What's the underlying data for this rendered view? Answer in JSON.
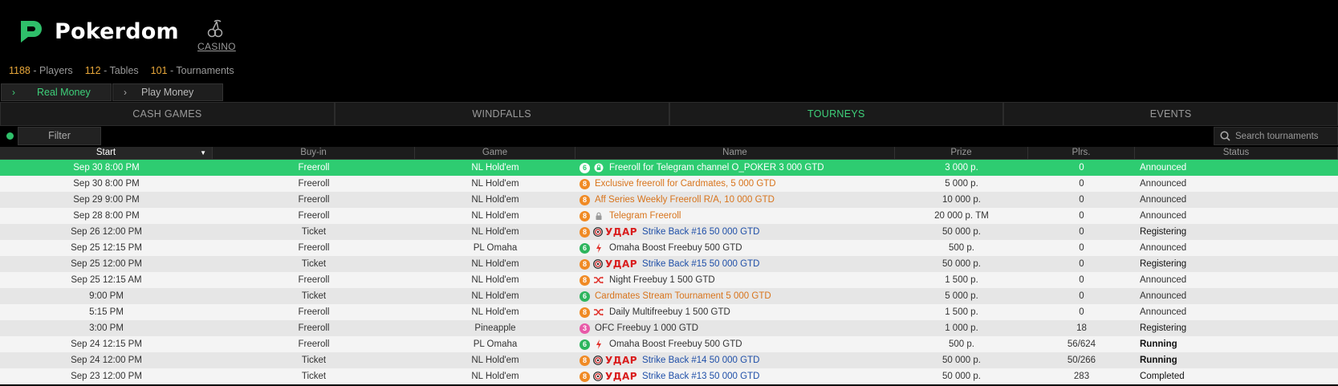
{
  "brand": {
    "name": "Pokerdom",
    "casino_label": "CASINO",
    "accent": "#2fbf6a"
  },
  "stats": [
    {
      "value": "1188",
      "label": " - Players"
    },
    {
      "value": "112",
      "label": " - Tables"
    },
    {
      "value": "101",
      "label": " - Tournaments"
    }
  ],
  "money_tabs": [
    {
      "label": "Real Money",
      "active": true
    },
    {
      "label": "Play Money",
      "active": false
    }
  ],
  "main_tabs": [
    {
      "label": "CASH GAMES",
      "active": false
    },
    {
      "label": "WINDFALLS",
      "active": false
    },
    {
      "label": "TOURNEYS",
      "active": true
    },
    {
      "label": "EVENTS",
      "active": false
    }
  ],
  "filter": {
    "label": "Filter"
  },
  "search": {
    "placeholder": "Search tournaments"
  },
  "columns": [
    "Start",
    "Buy-in",
    "Game",
    "Name",
    "Prize",
    "Plrs.",
    "Status"
  ],
  "rows": [
    {
      "start": "Sep 30 8:00 PM",
      "buyin": "Freeroll",
      "game": "NL Hold'em",
      "badge": "6",
      "badge_color": "green",
      "icon": "lock-icon",
      "udar": false,
      "name": "Freeroll for Telegram channel O_POKER 3 000 GTD",
      "name_style": "plain",
      "prize": "3 000 р.",
      "plrs": "0",
      "status": "Announced",
      "status_style": "normal",
      "selected": true
    },
    {
      "start": "Sep 30 8:00 PM",
      "buyin": "Freeroll",
      "game": "NL Hold'em",
      "badge": "8",
      "badge_color": "orange",
      "icon": "",
      "udar": false,
      "name": "Exclusive freeroll for Cardmates, 5 000 GTD",
      "name_style": "orange",
      "prize": "5 000 р.",
      "plrs": "0",
      "status": "Announced",
      "status_style": "normal"
    },
    {
      "start": "Sep 29 9:00 PM",
      "buyin": "Freeroll",
      "game": "NL Hold'em",
      "badge": "8",
      "badge_color": "orange",
      "icon": "",
      "udar": false,
      "name": "Aff Series Weekly Freeroll R/A, 10 000 GTD",
      "name_style": "orange",
      "prize": "10 000 р.",
      "plrs": "0",
      "status": "Announced",
      "status_style": "normal"
    },
    {
      "start": "Sep 28 8:00 PM",
      "buyin": "Freeroll",
      "game": "NL Hold'em",
      "badge": "8",
      "badge_color": "orange",
      "icon": "lock-icon",
      "udar": false,
      "name": "Telegram Freeroll",
      "name_style": "orange",
      "prize": "20 000 р. TM",
      "plrs": "0",
      "status": "Announced",
      "status_style": "normal"
    },
    {
      "start": "Sep 26 12:00 PM",
      "buyin": "Ticket",
      "game": "NL Hold'em",
      "badge": "8",
      "badge_color": "orange",
      "icon": "",
      "udar": true,
      "udar_text": "УДАР",
      "name": "Strike Back #16 50 000 GTD",
      "name_style": "blue",
      "prize": "50 000 р.",
      "plrs": "0",
      "status": "Registering",
      "status_style": "medium"
    },
    {
      "start": "Sep 25 12:15 PM",
      "buyin": "Freeroll",
      "game": "PL Omaha",
      "badge": "6",
      "badge_color": "green",
      "icon": "lightning-icon",
      "udar": false,
      "name": "Omaha Boost Freebuy 500 GTD",
      "name_style": "plain",
      "prize": "500 р.",
      "plrs": "0",
      "status": "Announced",
      "status_style": "normal"
    },
    {
      "start": "Sep 25 12:00 PM",
      "buyin": "Ticket",
      "game": "NL Hold'em",
      "badge": "8",
      "badge_color": "orange",
      "icon": "",
      "udar": true,
      "udar_text": "УДАР",
      "name": "Strike Back #15 50 000 GTD",
      "name_style": "blue",
      "prize": "50 000 р.",
      "plrs": "0",
      "status": "Registering",
      "status_style": "medium"
    },
    {
      "start": "Sep 25 12:15 AM",
      "buyin": "Freeroll",
      "game": "NL Hold'em",
      "badge": "8",
      "badge_color": "orange",
      "icon": "shuffle-icon",
      "udar": false,
      "name": "Night Freebuy 1 500 GTD",
      "name_style": "plain",
      "prize": "1 500 р.",
      "plrs": "0",
      "status": "Announced",
      "status_style": "normal"
    },
    {
      "start": "9:00 PM",
      "buyin": "Ticket",
      "game": "NL Hold'em",
      "badge": "6",
      "badge_color": "green",
      "icon": "",
      "udar": false,
      "name": "Cardmates Stream Tournament 5 000 GTD",
      "name_style": "orange",
      "prize": "5 000 р.",
      "plrs": "0",
      "status": "Announced",
      "status_style": "normal"
    },
    {
      "start": "5:15 PM",
      "buyin": "Freeroll",
      "game": "NL Hold'em",
      "badge": "8",
      "badge_color": "orange",
      "icon": "shuffle-icon",
      "udar": false,
      "name": "Daily Multifreebuy 1 500 GTD",
      "name_style": "plain",
      "prize": "1 500 р.",
      "plrs": "0",
      "status": "Announced",
      "status_style": "normal"
    },
    {
      "start": "3:00 PM",
      "buyin": "Freeroll",
      "game": "Pineapple",
      "badge": "3",
      "badge_color": "pink",
      "icon": "",
      "udar": false,
      "name": "OFC Freebuy 1 000 GTD",
      "name_style": "plain",
      "prize": "1 000 р.",
      "plrs": "18",
      "status": "Registering",
      "status_style": "medium"
    },
    {
      "start": "Sep 24 12:15 PM",
      "buyin": "Freeroll",
      "game": "PL Omaha",
      "badge": "6",
      "badge_color": "green",
      "icon": "lightning-icon",
      "udar": false,
      "name": "Omaha Boost Freebuy 500 GTD",
      "name_style": "plain",
      "prize": "500 р.",
      "plrs": "56/624",
      "status": "Running",
      "status_style": "bold"
    },
    {
      "start": "Sep 24 12:00 PM",
      "buyin": "Ticket",
      "game": "NL Hold'em",
      "badge": "8",
      "badge_color": "orange",
      "icon": "",
      "udar": true,
      "udar_text": "УДАР",
      "name": "Strike Back #14 50 000 GTD",
      "name_style": "blue",
      "prize": "50 000 р.",
      "plrs": "50/266",
      "status": "Running",
      "status_style": "bold"
    },
    {
      "start": "Sep 23 12:00 PM",
      "buyin": "Ticket",
      "game": "NL Hold'em",
      "badge": "8",
      "badge_color": "orange",
      "icon": "",
      "udar": true,
      "udar_text": "УДАР",
      "name": "Strike Back #13 50 000 GTD",
      "name_style": "blue",
      "prize": "50 000 р.",
      "plrs": "283",
      "status": "Completed",
      "status_style": "medium"
    }
  ]
}
